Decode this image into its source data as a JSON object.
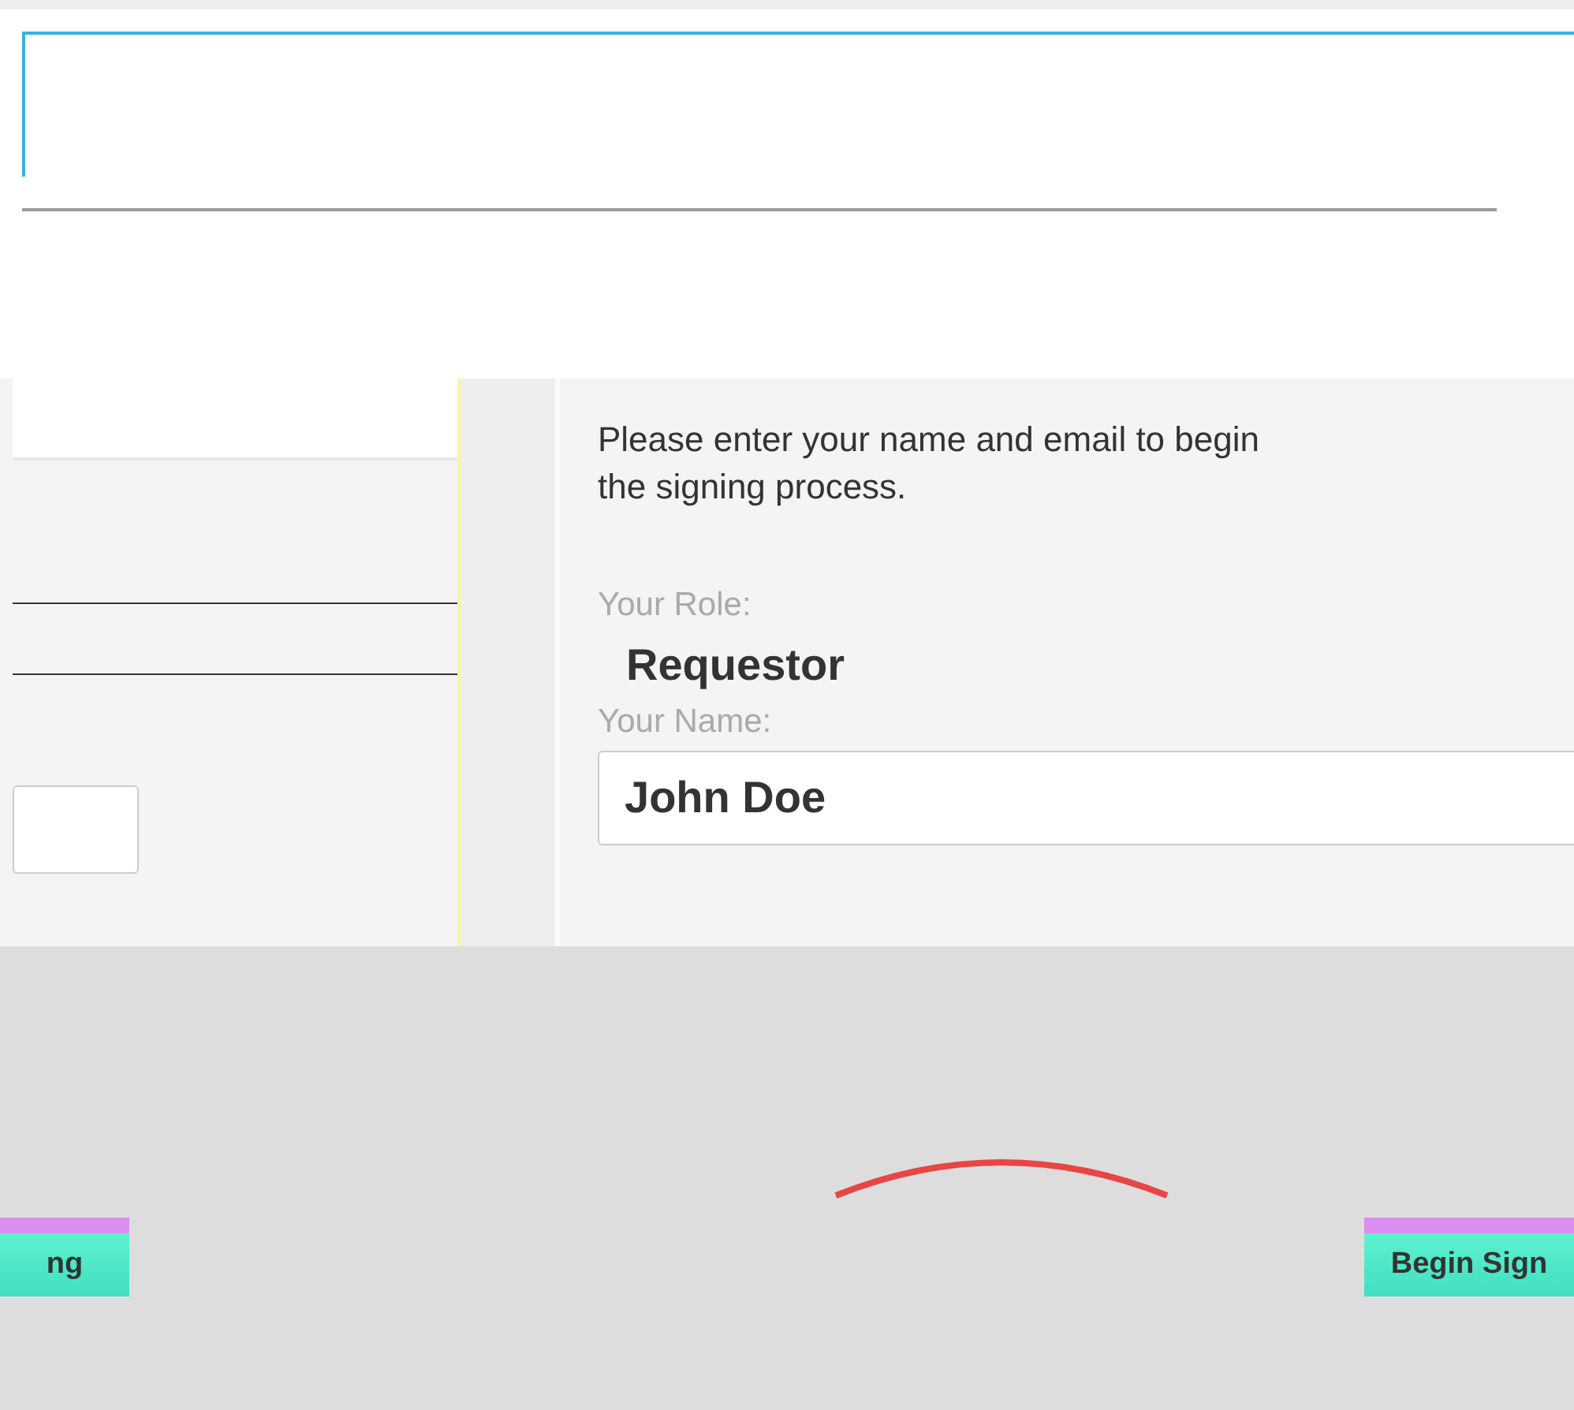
{
  "intro": {
    "text": "Please enter your name and email to begin the signing process."
  },
  "role": {
    "label": "Your Role:",
    "value": "Requestor"
  },
  "name_field": {
    "label": "Your Name:",
    "value": "John Doe"
  },
  "buttons": [
    {
      "label": "ng"
    },
    {
      "label": "Begin Sign"
    }
  ]
}
